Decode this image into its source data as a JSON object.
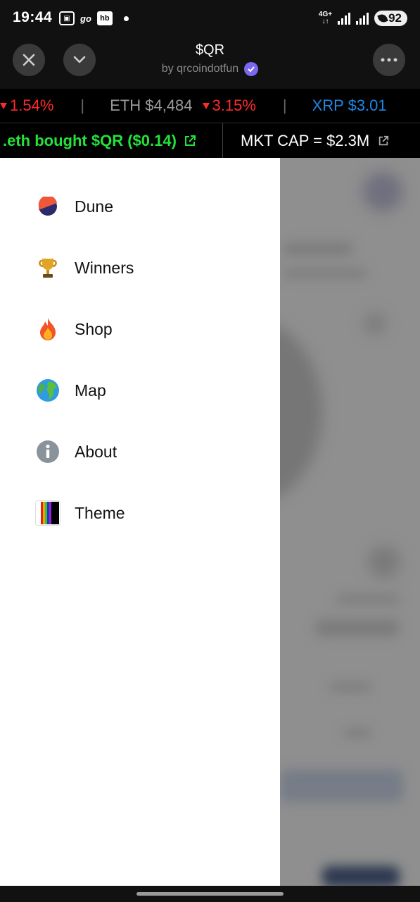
{
  "status": {
    "time": "19:44",
    "carrier_icons": [
      "go"
    ],
    "hb": "hb",
    "network": "4G+",
    "battery": "92"
  },
  "header": {
    "title": "$QR",
    "subtitle": "by qrcoindotfun"
  },
  "ticker1": {
    "first_change": "1.54%",
    "eth_label": "ETH $4,484",
    "eth_change": "3.15%",
    "xrp_label": "XRP $3.01",
    "separator": "|"
  },
  "ticker2": {
    "bought": ".eth bought $QR ($0.14)",
    "mkt_cap": "MKT CAP = $2.3M"
  },
  "menu": [
    {
      "label": "Dune",
      "icon": "dune-icon"
    },
    {
      "label": "Winners",
      "icon": "trophy-icon"
    },
    {
      "label": "Shop",
      "icon": "fire-icon"
    },
    {
      "label": "Map",
      "icon": "globe-icon"
    },
    {
      "label": "About",
      "icon": "info-icon"
    },
    {
      "label": "Theme",
      "icon": "theme-icon"
    }
  ],
  "colors": {
    "accent_green": "#22e33a",
    "down_red": "#ff2a2a",
    "xrp_blue": "#1e88e5",
    "verified_purple": "#7b68ee"
  }
}
